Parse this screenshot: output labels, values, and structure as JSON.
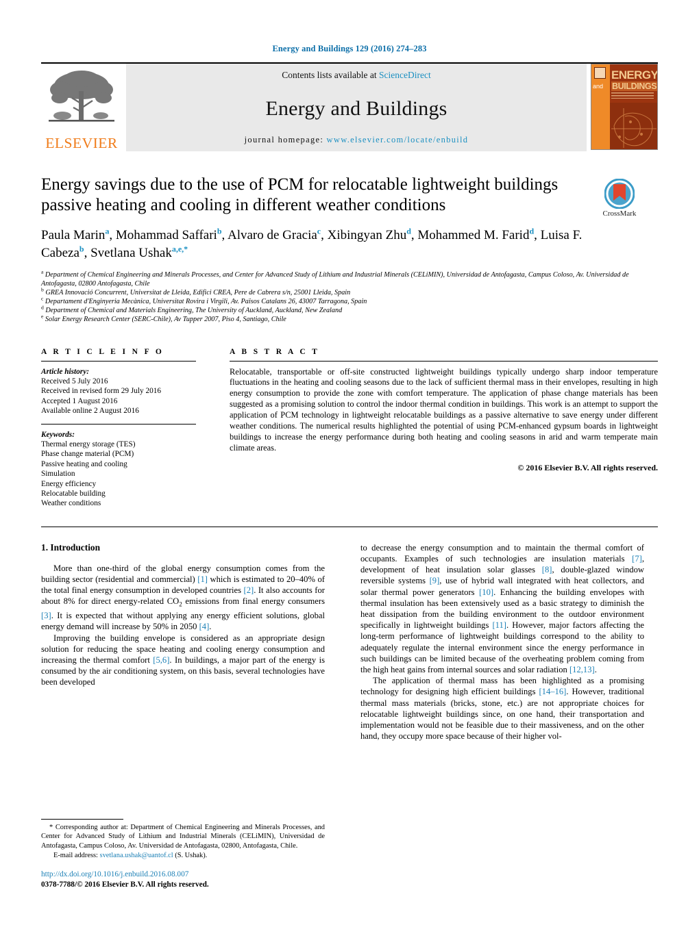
{
  "running_head": "Energy and Buildings 129 (2016) 274–283",
  "masthead": {
    "publisher_name": "ELSEVIER",
    "contents_prefix": "Contents lists available at ",
    "contents_link": "ScienceDirect",
    "journal_title": "Energy and Buildings",
    "homepage_prefix": "journal homepage: ",
    "homepage_url": "www.elsevier.com/locate/enbuild",
    "cover": {
      "line_and": "and",
      "line_energy": "ENERGY",
      "line_buildings": "BUILDINGS"
    }
  },
  "article": {
    "title": "Energy savings due to the use of PCM for relocatable lightweight buildings passive heating and cooling in different weather conditions",
    "crossmark_label": "CrossMark",
    "authors_line_1": "Paula Marin",
    "authors": [
      {
        "name": "Paula Marin",
        "sup": "a",
        "sep": ", "
      },
      {
        "name": "Mohammad Saffari",
        "sup": "b",
        "sep": ", "
      },
      {
        "name": "Alvaro de Gracia",
        "sup": "c",
        "sep": ", "
      },
      {
        "name": "Xibingyan Zhu",
        "sup": "d",
        "sep": ", "
      },
      {
        "name": "Mohammed M. Farid",
        "sup": "d",
        "sep": ", "
      },
      {
        "name": "Luisa F. Cabeza",
        "sup": "b",
        "sep": ", "
      },
      {
        "name": "Svetlana Ushak",
        "sup": "a,e,*",
        "sep": ""
      }
    ],
    "affiliations": [
      {
        "key": "a",
        "text": "Department of Chemical Engineering and Minerals Processes, and Center for Advanced Study of Lithium and Industrial Minerals (CELiMIN), Universidad de Antofagasta, Campus Coloso, Av. Universidad de Antofagasta, 02800 Antofagasta, Chile"
      },
      {
        "key": "b",
        "text": "GREA Innovació Concurrent, Universitat de Lleida, Edifici CREA, Pere de Cabrera s/n, 25001 Lleida, Spain"
      },
      {
        "key": "c",
        "text": "Departament d'Enginyeria Mecànica, Universitat Rovira i Virgili, Av. Països Catalans 26, 43007 Tarragona, Spain"
      },
      {
        "key": "d",
        "text": "Department of Chemical and Materials Engineering, The University of Auckland, Auckland, New Zealand"
      },
      {
        "key": "e",
        "text": "Solar Energy Research Center (SERC-Chile), Av Tupper 2007, Piso 4, Santiago, Chile"
      }
    ]
  },
  "article_info": {
    "heading": "A R T I C L E    I N F O",
    "history_label": "Article history:",
    "history": [
      "Received 5 July 2016",
      "Received in revised form 29 July 2016",
      "Accepted 1 August 2016",
      "Available online 2 August 2016"
    ],
    "keywords_label": "Keywords:",
    "keywords": [
      "Thermal energy storage (TES)",
      "Phase change material (PCM)",
      "Passive heating and cooling",
      "Simulation",
      "Energy efficiency",
      "Relocatable building",
      "Weather conditions"
    ]
  },
  "abstract": {
    "heading": "A B S T R A C T",
    "text": "Relocatable, transportable or off-site constructed lightweight buildings typically undergo sharp indoor temperature fluctuations in the heating and cooling seasons due to the lack of sufficient thermal mass in their envelopes, resulting in high energy consumption to provide the zone with comfort temperature. The application of phase change materials has been suggested as a promising solution to control the indoor thermal condition in buildings. This work is an attempt to support the application of PCM technology in lightweight relocatable buildings as a passive alternative to save energy under different weather conditions. The numerical results highlighted the potential of using PCM-enhanced gypsum boards in lightweight buildings to increase the energy performance during both heating and cooling seasons in arid and warm temperate main climate areas.",
    "copyright": "© 2016 Elsevier B.V. All rights reserved."
  },
  "body": {
    "section_heading": "1.  Introduction",
    "left_paragraphs": [
      "More than one-third of the global energy consumption comes from the building sector (residential and commercial) [1] which is estimated to 20–40% of the total final energy consumption in developed countries [2]. It also accounts for about 8% for direct energy-related CO2 emissions from final energy consumers [3]. It is expected that without applying any energy efficient solutions, global energy demand will increase by 50% in 2050 [4].",
      "Improving the building envelope is considered as an appropriate design solution for reducing the space heating and cooling energy consumption and increasing the thermal comfort [5,6]. In buildings, a major part of the energy is consumed by the air conditioning system, on this basis, several technologies have been developed"
    ],
    "right_paragraphs": [
      "to decrease the energy consumption and to maintain the thermal comfort of occupants. Examples of such technologies are insulation materials [7], development of heat insulation solar glasses [8], double-glazed window reversible systems [9], use of hybrid wall integrated with heat collectors, and solar thermal power generators [10]. Enhancing the building envelopes with thermal insulation has been extensively used as a basic strategy to diminish the heat dissipation from the building environment to the outdoor environment specifically in lightweight buildings [11]. However, major factors affecting the long-term performance of lightweight buildings correspond to the ability to adequately regulate the internal environment since the energy performance in such buildings can be limited because of the overheating problem coming from the high heat gains from internal sources and solar radiation [12,13].",
      "The application of thermal mass has been highlighted as a promising technology for designing high efficient buildings [14–16]. However, traditional thermal mass materials (bricks, stone, etc.) are not appropriate choices for relocatable lightweight buildings since, on one hand, their transportation and implementation would not be feasible due to their massiveness, and on the other hand, they occupy more space because of their higher vol-"
    ]
  },
  "footer": {
    "corresponding_note": "* Corresponding author at: Department of Chemical Engineering and Minerals Processes, and Center for Advanced Study of Lithium and Industrial Minerals (CELiMIN), Universidad de Antofagasta, Campus Coloso, Av. Universidad de Antofagasta, 02800, Antofagasta, Chile.",
    "email_label": "E-mail address:",
    "email": "svetlana.ushak@uantof.cl",
    "email_owner": "(S. Ushak).",
    "doi": "http://dx.doi.org/10.1016/j.enbuild.2016.08.007",
    "issn_line": "0378-7788/© 2016 Elsevier B.V. All rights reserved."
  },
  "colors": {
    "link": "#1a7fb5",
    "header_blue": "#0b6ea8",
    "elsevier_orange": "#f07c1a"
  }
}
